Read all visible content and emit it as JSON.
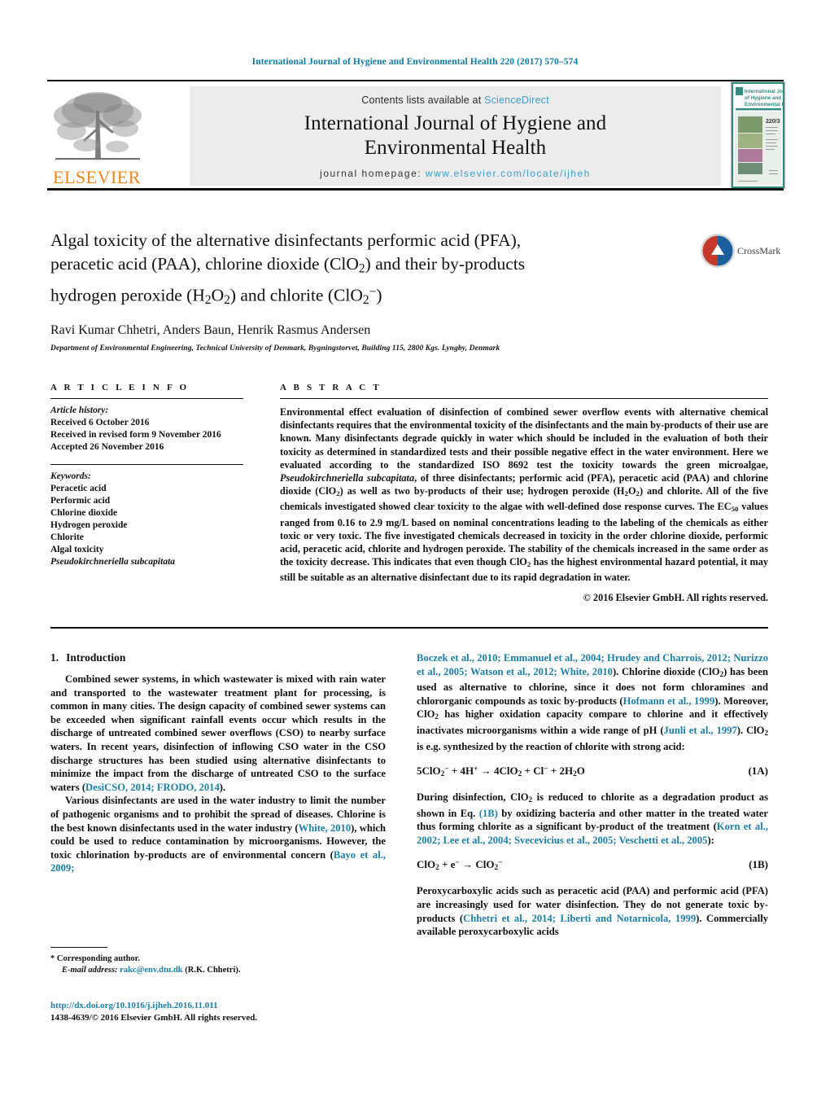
{
  "running_head": "International Journal of Hygiene and Environmental Health 220 (2017) 570–574",
  "masthead": {
    "publisher_name": "ELSEVIER",
    "contents_prefix": "Contents lists available at",
    "sciencedirect": "ScienceDirect",
    "journal_title_line1": "International Journal of Hygiene and",
    "journal_title_line2": "Environmental Health",
    "homepage_prefix": "journal homepage:",
    "homepage_url": "www.elsevier.com/locate/ijheh",
    "cover_title_line1": "International Journal",
    "cover_title_line2": "of Hygiene and",
    "cover_title_line3": "Environmental Health",
    "cover_volume": "220/3"
  },
  "article": {
    "title_line1": "Algal toxicity of the alternative disinfectants performic acid (PFA),",
    "title_line2_a": "peracetic acid (PAA), chlorine dioxide (ClO",
    "title_line2_b": ") and their by-products",
    "title_line3_a": "hydrogen peroxide (H",
    "title_line3_b": "O",
    "title_line3_c": ") and chlorite (ClO",
    "title_line3_d": ")",
    "authors": "Ravi Kumar Chhetri, Anders Baun, Henrik Rasmus Andersen",
    "corresponding_marker": "*",
    "affiliation": "Department of Environmental Engineering, Technical University of Denmark, Bygningstorvet, Building 115, 2800 Kgs. Lyngby, Denmark",
    "crossmark_label": "CrossMark"
  },
  "article_info": {
    "heading": "A R T I C L E   I N F O",
    "history_label": "Article history:",
    "history": [
      "Received 6 October 2016",
      "Received in revised form 9 November 2016",
      "Accepted 26 November 2016"
    ],
    "keywords_label": "Keywords:",
    "keywords": [
      "Peracetic acid",
      "Performic acid",
      "Chlorine dioxide",
      "Hydrogen peroxide",
      "Chlorite",
      "Algal toxicity"
    ],
    "keyword_species": "Pseudokirchneriella subcapitata"
  },
  "abstract": {
    "heading": "A B S T R A C T",
    "text_part1": "Environmental effect evaluation of disinfection of combined sewer overflow events with alternative chemical disinfectants requires that the environmental toxicity of the disinfectants and the main by-products of their use are known. Many disinfectants degrade quickly in water which should be included in the evaluation of both their toxicity as determined in standardized tests and their possible negative effect in the water environment. Here we evaluated according to the standardized ISO 8692 test the toxicity towards the green microalgae, ",
    "species": "Pseudokirchneriella subcapitata",
    "text_part2": ", of three disinfectants; performic acid (PFA), peracetic acid (PAA) and chlorine dioxide (ClO",
    "text_part3": ") as well as two by-products of their use; hydrogen peroxide (H",
    "text_part4": "O",
    "text_part5": ") and chlorite. All of the five chemicals investigated showed clear toxicity to the algae with well-defined dose response curves. The EC",
    "ec_sub": "50",
    "text_part6": " values ranged from 0.16 to 2.9 mg/L based on nominal concentrations leading to the labeling of the chemicals as either toxic or very toxic. The five investigated chemicals decreased in toxicity in the order chlorine dioxide, performic acid, peracetic acid, chlorite and hydrogen peroxide. The stability of the chemicals increased in the same order as the toxicity decrease. This indicates that even though ClO",
    "text_part7": " has the highest environmental hazard potential, it may still be suitable as an alternative disinfectant due to its rapid degradation in water.",
    "copyright": "© 2016 Elsevier GmbH. All rights reserved."
  },
  "introduction": {
    "heading_number": "1.",
    "heading_text": "Introduction",
    "left_p1": "Combined sewer systems, in which wastewater is mixed with rain water and transported to the wastewater treatment plant for processing, is common in many cities. The design capacity of combined sewer systems can be exceeded when significant rainfall events occur which results in the discharge of untreated combined sewer overflows (CSO) to nearby surface waters. In recent years, disinfection of inflowing CSO water in the CSO discharge structures has been studied using alternative disinfectants to minimize the impact from the discharge of untreated CSO to the surface waters (",
    "left_p1_cite": "DesiCSO, 2014; FRODO, 2014",
    "left_p1_end": ").",
    "left_p2_a": "Various disinfectants are used in the water industry to limit the number of pathogenic organisms and to prohibit the spread of diseases. Chlorine is the best known disinfectants used in the water industry (",
    "left_p2_cite1": "White, 2010",
    "left_p2_b": "), which could be used to reduce contamination by microorganisms. However, the toxic chlorination by-products are of environmental concern (",
    "left_p2_cite2": "Bayo et al., 2009;",
    "right_cont_cite": "Boczek et al., 2010; Emmanuel et al., 2004; Hrudey and Charrois, 2012; Nurizzo et al., 2005; Watson et al., 2012; White, 2010",
    "right_cont_a": "). Chlorine dioxide (ClO",
    "right_cont_b": ") has been used as alternative to chlorine, since it does not form chloramines and chlororganic compounds as toxic by-products (",
    "right_cite_hofmann": "Hofmann et al., 1999",
    "right_cont_c": "). Moreover, ClO",
    "right_cont_d": " has higher oxidation capacity compare to chlorine and it effectively inactivates microorganisms within a wide range of pH (",
    "right_cite_junli": "Junli et al., 1997",
    "right_cont_e": "). ClO",
    "right_cont_f": " is e.g. synthesized by the reaction of chlorite with strong acid:",
    "eq1a_number": "(1A)",
    "eq1b_number": "(1B)",
    "right_p2_a": "During disinfection, ClO",
    "right_p2_b": " is reduced to chlorite as a degradation product as shown in Eq. ",
    "right_p2_eqlink": "(1B)",
    "right_p2_c": " by oxidizing bacteria and other matter in the treated water thus forming chlorite as a significant by-product of the treatment (",
    "right_p2_cite": "Korn et al., 2002; Lee et al., 2004; Svecevicius et al., 2005; Veschetti et al., 2005",
    "right_p2_d": "):",
    "right_p3_a": "Peroxycarboxylic acids such as peracetic acid (PAA) and performic acid (PFA) are increasingly used for water disinfection. They do not generate toxic by-products (",
    "right_p3_cite": "Chhetri et al., 2014; Liberti and Notarnicola, 1999",
    "right_p3_b": "). Commercially available peroxycarboxylic acids"
  },
  "footnote": {
    "star": "*",
    "corresponding": "Corresponding author.",
    "email_label": "E-mail address:",
    "email": "rakc@env.dtu.dk",
    "email_suffix": "(R.K. Chhetri)."
  },
  "doi_block": {
    "doi_url": "http://dx.doi.org/10.1016/j.ijheh.2016.11.011",
    "issn_line": "1438-4639/© 2016 Elsevier GmbH. All rights reserved."
  },
  "colors": {
    "link": "#1b7fa8",
    "running_head": "#0b7ba8",
    "elsevier_orange": "#f08519",
    "banner_bg": "#ececec",
    "sciencedirect": "#3e9cc6"
  }
}
